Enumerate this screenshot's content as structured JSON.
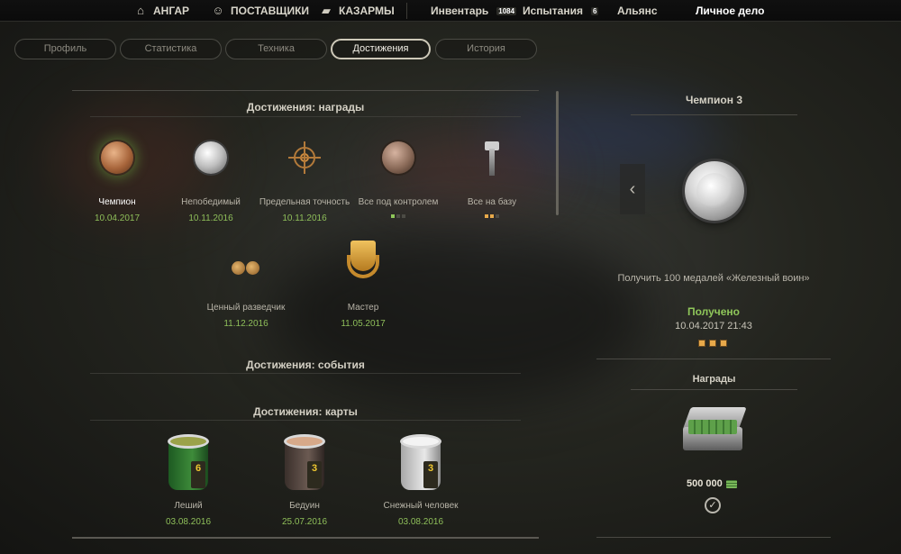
{
  "nav": {
    "hangar": "АНГАР",
    "suppliers": "ПОСТАВЩИКИ",
    "barracks": "КАЗАРМЫ",
    "inventory": "Инвентарь",
    "inventory_count": "1084",
    "trials": "Испытания",
    "trials_count": "6",
    "alliance": "Альянс",
    "personal_file": "Личное дело"
  },
  "tabs": [
    "Профиль",
    "Статистика",
    "Техника",
    "Достижения",
    "История"
  ],
  "active_tab": "Достижения",
  "sections": {
    "awards": "Достижения: награды",
    "events": "Достижения: события",
    "maps": "Достижения: карты"
  },
  "awards": [
    {
      "name": "Чемпион",
      "date": "10.04.2017",
      "icon": "bronze-medal-icon"
    },
    {
      "name": "Непобедимый",
      "date": "10.11.2016",
      "icon": "silver-medal-icon"
    },
    {
      "name": "Предельная точность",
      "date": "10.11.2016",
      "icon": "crosshair-icon"
    },
    {
      "name": "Все под контролем",
      "date": "",
      "icon": "shield-medal-icon"
    },
    {
      "name": "Все на базу",
      "date": "",
      "icon": "hammer-icon"
    },
    {
      "name": "Ценный разведчик",
      "date": "11.12.2016",
      "icon": "binoculars-icon"
    },
    {
      "name": "Мастер",
      "date": "11.05.2017",
      "icon": "gold-badge-icon"
    }
  ],
  "maps": [
    {
      "name": "Леший",
      "date": "03.08.2016",
      "icon": "paint-can-icon",
      "level": "6"
    },
    {
      "name": "Бедуин",
      "date": "25.07.2016",
      "icon": "paint-can-icon",
      "level": "3"
    },
    {
      "name": "Снежный человек",
      "date": "03.08.2016",
      "icon": "paint-can-icon",
      "level": "3"
    }
  ],
  "detail": {
    "title": "Чемпион 3",
    "description": "Получить 100 медалей «Железный воин»",
    "status": "Получено",
    "received_date": "10.04.2017 21:43",
    "rewards_title": "Награды",
    "reward_amount": "500 000"
  },
  "colors": {
    "accent_green": "#8fc65a",
    "dot_gold": "#e8a94a"
  }
}
